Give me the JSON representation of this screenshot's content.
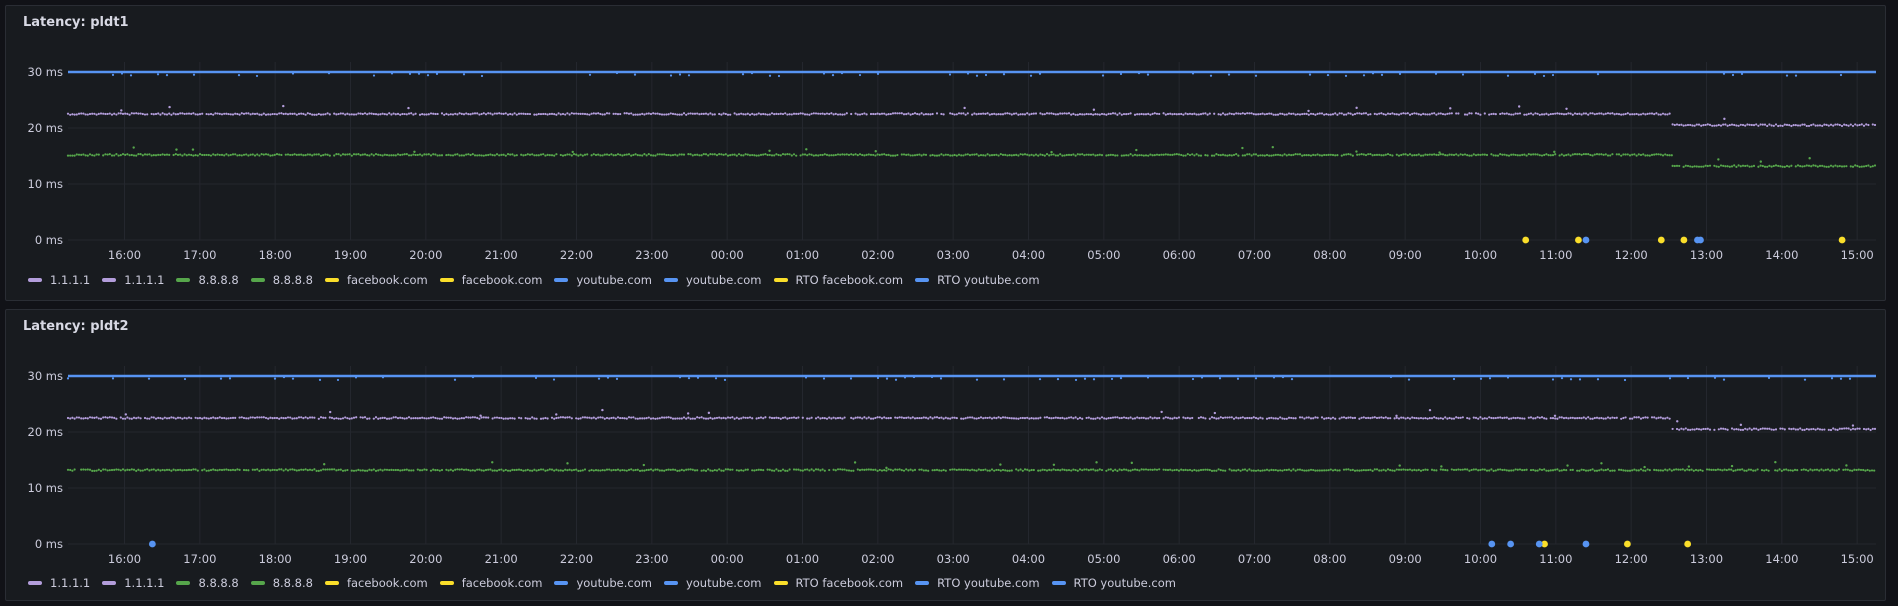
{
  "panels": [
    {
      "title": "Latency: pldt1",
      "legend": [
        {
          "label": "1.1.1.1",
          "color": "#b39ddb"
        },
        {
          "label": "1.1.1.1",
          "color": "#b39ddb"
        },
        {
          "label": "8.8.8.8",
          "color": "#56a64b"
        },
        {
          "label": "8.8.8.8",
          "color": "#56a64b"
        },
        {
          "label": "facebook.com",
          "color": "#fade2a"
        },
        {
          "label": "facebook.com",
          "color": "#fade2a"
        },
        {
          "label": "youtube.com",
          "color": "#5794f2"
        },
        {
          "label": "youtube.com",
          "color": "#5794f2"
        },
        {
          "label": "RTO facebook.com",
          "color": "#fade2a"
        },
        {
          "label": "RTO youtube.com",
          "color": "#5794f2"
        }
      ]
    },
    {
      "title": "Latency: pldt2",
      "legend": [
        {
          "label": "1.1.1.1",
          "color": "#b39ddb"
        },
        {
          "label": "1.1.1.1",
          "color": "#b39ddb"
        },
        {
          "label": "8.8.8.8",
          "color": "#56a64b"
        },
        {
          "label": "8.8.8.8",
          "color": "#56a64b"
        },
        {
          "label": "facebook.com",
          "color": "#fade2a"
        },
        {
          "label": "facebook.com",
          "color": "#fade2a"
        },
        {
          "label": "youtube.com",
          "color": "#5794f2"
        },
        {
          "label": "youtube.com",
          "color": "#5794f2"
        },
        {
          "label": "RTO facebook.com",
          "color": "#fade2a"
        },
        {
          "label": "RTO youtube.com",
          "color": "#5794f2"
        },
        {
          "label": "RTO youtube.com",
          "color": "#5794f2"
        }
      ]
    }
  ],
  "chart_data": [
    {
      "type": "scatter",
      "title": "Latency: pldt1",
      "y_ticks": [
        "0 ms",
        "10 ms",
        "20 ms",
        "30 ms"
      ],
      "ylim": [
        0,
        30
      ],
      "x_ticks": [
        "16:00",
        "17:00",
        "18:00",
        "19:00",
        "20:00",
        "21:00",
        "22:00",
        "23:00",
        "00:00",
        "01:00",
        "02:00",
        "03:00",
        "04:00",
        "05:00",
        "06:00",
        "07:00",
        "08:00",
        "09:00",
        "10:00",
        "11:00",
        "12:00",
        "13:00",
        "14:00",
        "15:00"
      ],
      "x_range_hours": [
        15.25,
        39.25
      ],
      "grid": true,
      "legend_placement": "bottom",
      "series": [
        {
          "name": "1.1.1.1",
          "color": "#b39ddb",
          "segments": [
            {
              "from": 15.25,
              "to": 36.55,
              "value": 22.5
            },
            {
              "from": 36.55,
              "to": 39.25,
              "value": 20.5
            }
          ]
        },
        {
          "name": "8.8.8.8",
          "color": "#56a64b",
          "segments": [
            {
              "from": 15.25,
              "to": 36.55,
              "value": 15.2
            },
            {
              "from": 36.55,
              "to": 39.25,
              "value": 13.2
            }
          ]
        },
        {
          "name": "youtube.com",
          "color": "#5794f2",
          "segments": [
            {
              "from": 15.25,
              "to": 39.25,
              "value": 30
            }
          ]
        },
        {
          "name": "RTO facebook.com",
          "color": "#fade2a",
          "points": [
            [
              34.6,
              0
            ],
            [
              35.3,
              0
            ],
            [
              36.4,
              0
            ],
            [
              36.7,
              0
            ],
            [
              38.8,
              0
            ]
          ]
        },
        {
          "name": "RTO youtube.com",
          "color": "#5794f2",
          "points": [
            [
              35.4,
              0
            ],
            [
              36.88,
              0
            ],
            [
              36.92,
              0
            ]
          ]
        }
      ]
    },
    {
      "type": "scatter",
      "title": "Latency: pldt2",
      "y_ticks": [
        "0 ms",
        "10 ms",
        "20 ms",
        "30 ms"
      ],
      "ylim": [
        0,
        30
      ],
      "x_ticks": [
        "16:00",
        "17:00",
        "18:00",
        "19:00",
        "20:00",
        "21:00",
        "22:00",
        "23:00",
        "00:00",
        "01:00",
        "02:00",
        "03:00",
        "04:00",
        "05:00",
        "06:00",
        "07:00",
        "08:00",
        "09:00",
        "10:00",
        "11:00",
        "12:00",
        "13:00",
        "14:00",
        "15:00"
      ],
      "x_range_hours": [
        15.25,
        39.25
      ],
      "grid": true,
      "legend_placement": "bottom",
      "series": [
        {
          "name": "1.1.1.1",
          "color": "#b39ddb",
          "segments": [
            {
              "from": 15.25,
              "to": 36.55,
              "value": 22.5
            },
            {
              "from": 36.55,
              "to": 39.25,
              "value": 20.5
            }
          ]
        },
        {
          "name": "8.8.8.8",
          "color": "#56a64b",
          "segments": [
            {
              "from": 15.25,
              "to": 39.25,
              "value": 13.2
            }
          ]
        },
        {
          "name": "youtube.com",
          "color": "#5794f2",
          "segments": [
            {
              "from": 15.25,
              "to": 39.25,
              "value": 30
            }
          ]
        },
        {
          "name": "RTO facebook.com",
          "color": "#fade2a",
          "points": [
            [
              34.85,
              0
            ],
            [
              35.95,
              0
            ],
            [
              36.75,
              0
            ]
          ]
        },
        {
          "name": "RTO youtube.com",
          "color": "#5794f2",
          "points": [
            [
              16.37,
              0
            ],
            [
              34.15,
              0
            ],
            [
              34.4,
              0
            ],
            [
              34.78,
              0
            ],
            [
              35.4,
              0
            ]
          ]
        }
      ]
    }
  ]
}
